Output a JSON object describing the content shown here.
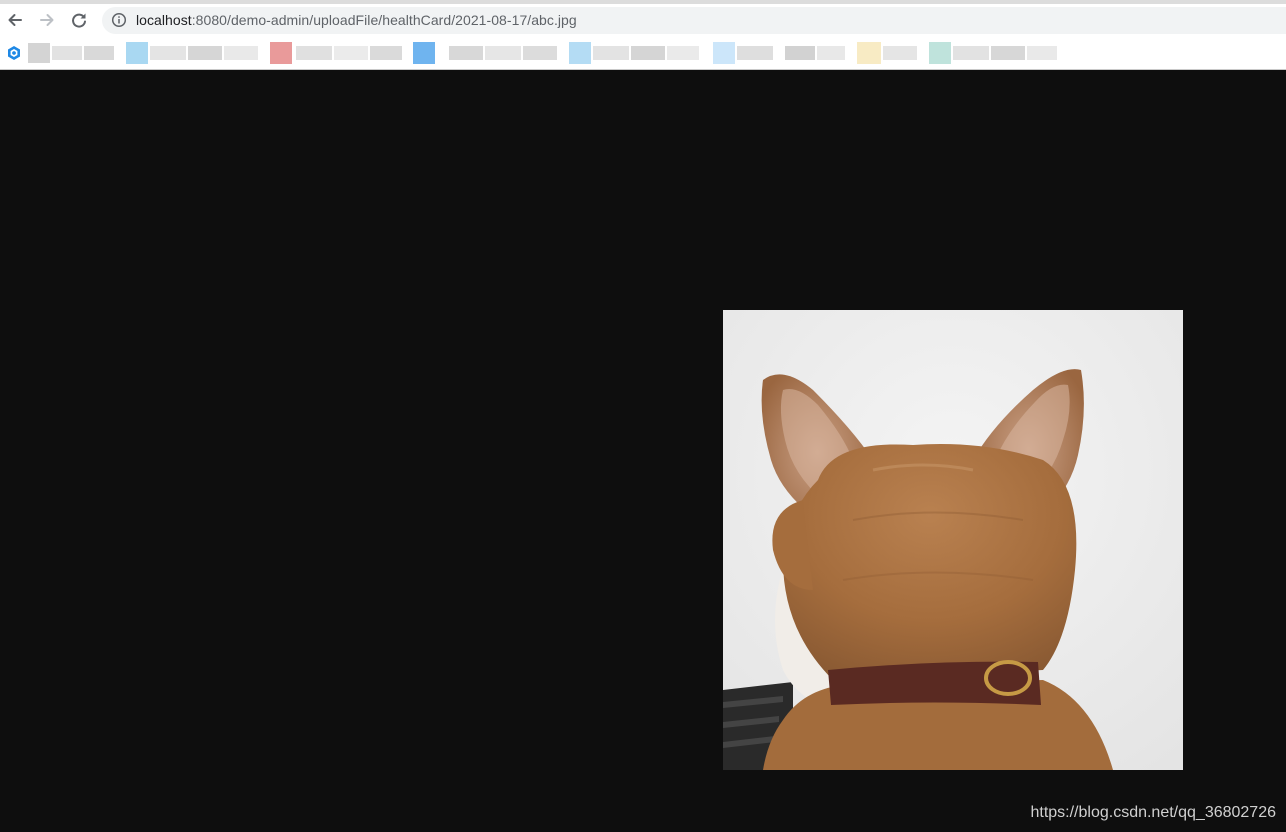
{
  "browser": {
    "url": {
      "host": "localhost",
      "rest": ":8080/demo-admin/uploadFile/healthCard/2021-08-17/abc.jpg"
    },
    "icons": {
      "back": "arrow-left-icon",
      "forward": "arrow-right-icon",
      "reload": "reload-icon",
      "site_info": "info-icon"
    }
  },
  "image": {
    "subject": "cat-back-of-head",
    "colors": {
      "fur": "#a9713f",
      "background": "#efefef",
      "collar": "#5a2a22"
    }
  },
  "watermark": "https://blog.csdn.net/qq_36802726",
  "colors": {
    "page_background": "#0e0e0e",
    "toolbar": "#ffffff",
    "omnibox": "#f1f3f4"
  }
}
